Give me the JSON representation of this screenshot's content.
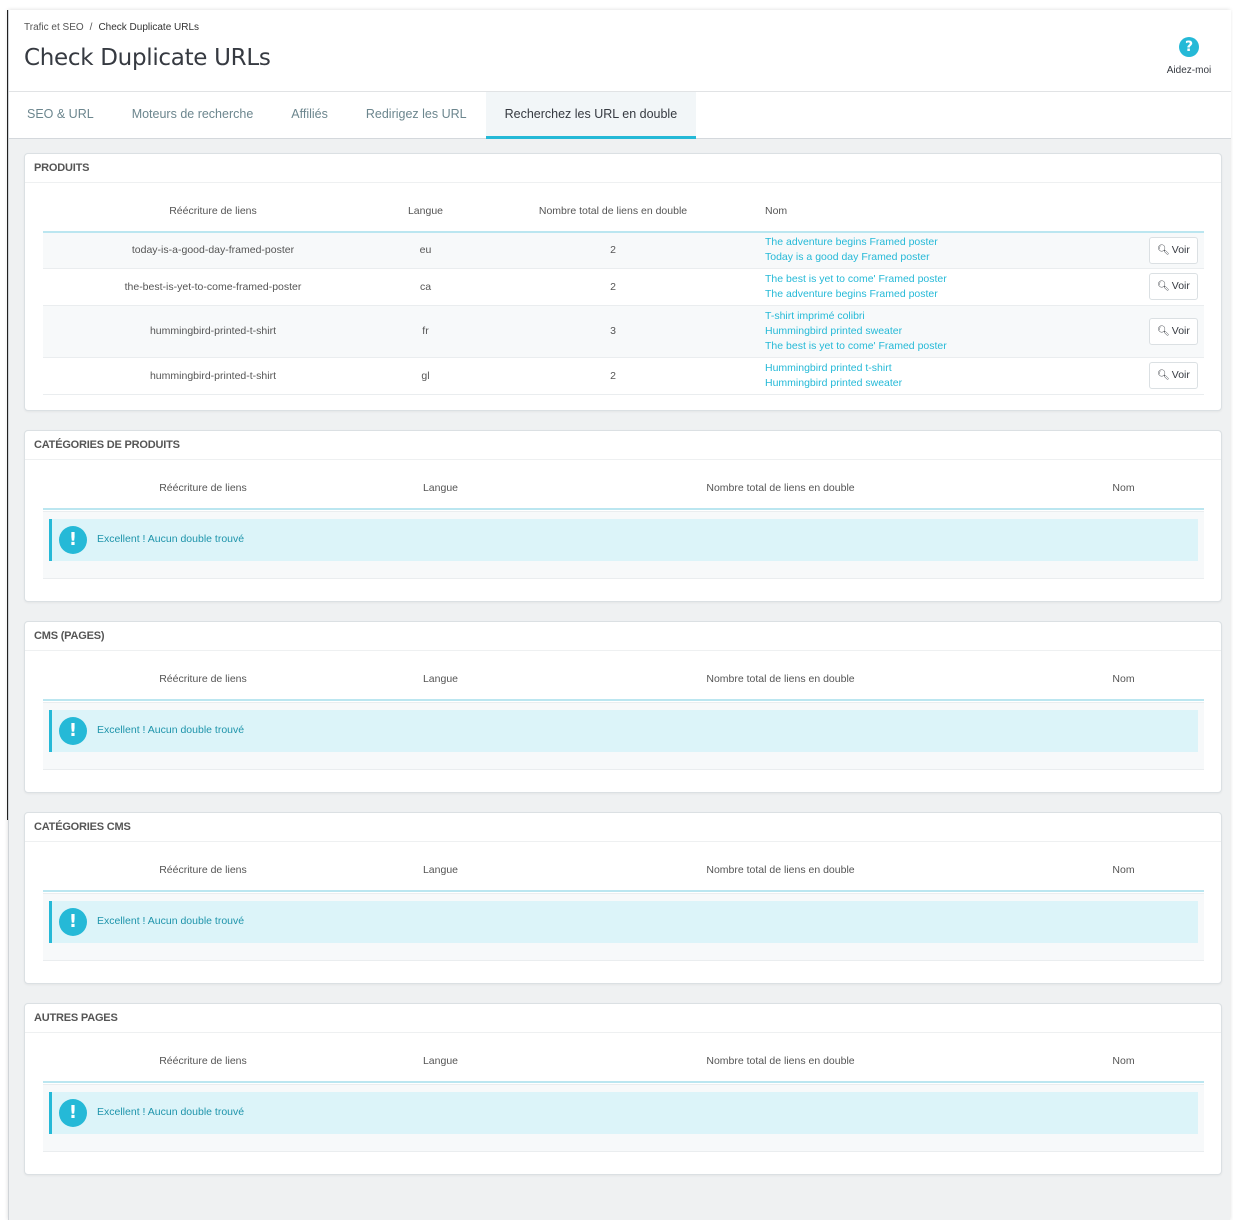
{
  "breadcrumb": {
    "parent": "Trafic et SEO",
    "separator": "/",
    "current": "Check Duplicate URLs"
  },
  "page_title": "Check Duplicate URLs",
  "help": {
    "icon": "question-circle-icon",
    "label": "Aidez-moi"
  },
  "tabs": [
    {
      "label": "SEO & URL",
      "active": false
    },
    {
      "label": "Moteurs de recherche",
      "active": false
    },
    {
      "label": "Affiliés",
      "active": false
    },
    {
      "label": "Redirigez les URL",
      "active": false
    },
    {
      "label": "Recherchez les URL en double",
      "active": true
    }
  ],
  "columns": {
    "rewrite": "Réécriture de liens",
    "lang": "Langue",
    "total": "Nombre total de liens en double",
    "name": "Nom"
  },
  "products": {
    "heading": "PRODUITS",
    "view_label": "Voir",
    "rows": [
      {
        "rewrite": "today-is-a-good-day-framed-poster",
        "lang": "eu",
        "total": "2",
        "names": [
          "The adventure begins Framed poster",
          "Today is a good day Framed poster"
        ]
      },
      {
        "rewrite": "the-best-is-yet-to-come-framed-poster",
        "lang": "ca",
        "total": "2",
        "names": [
          "The best is yet to come' Framed poster",
          "The adventure begins Framed poster"
        ]
      },
      {
        "rewrite": "hummingbird-printed-t-shirt",
        "lang": "fr",
        "total": "3",
        "names": [
          "T-shirt imprimé colibri",
          "Hummingbird printed sweater",
          "The best is yet to come' Framed poster"
        ]
      },
      {
        "rewrite": "hummingbird-printed-t-shirt",
        "lang": "gl",
        "total": "2",
        "names": [
          "Hummingbird printed t-shirt",
          "Hummingbird printed sweater"
        ]
      }
    ]
  },
  "empty_message": "Excellent ! Aucun double trouvé",
  "empty_sections": [
    {
      "heading": "CATÉGORIES DE PRODUITS"
    },
    {
      "heading": "CMS (PAGES)"
    },
    {
      "heading": "CATÉGORIES CMS"
    },
    {
      "heading": "AUTRES PAGES"
    }
  ],
  "colors": {
    "accent": "#25b9d7",
    "alert_bg": "#dcf4f9",
    "page_bg": "#eff1f2"
  }
}
